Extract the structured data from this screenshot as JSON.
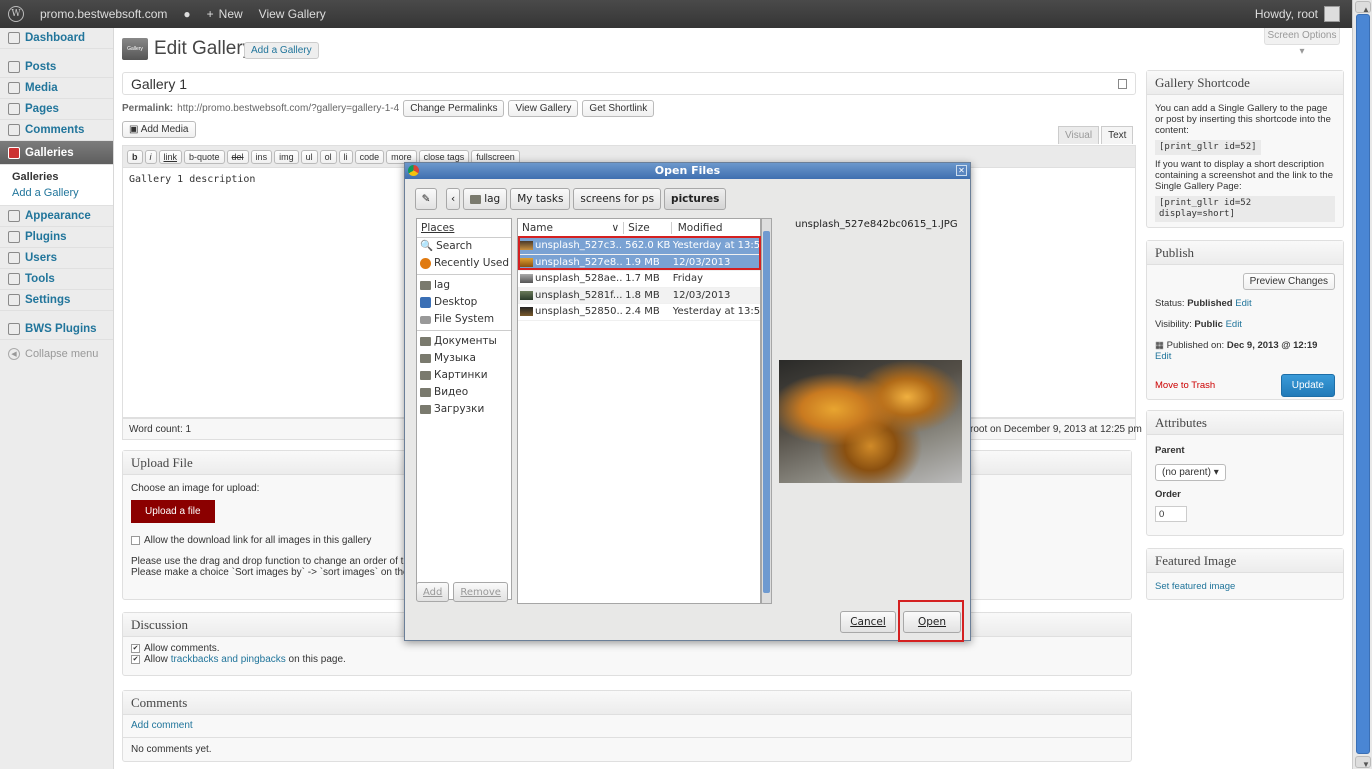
{
  "adminbar": {
    "site": "promo.bestwebsoft.com",
    "new": "New",
    "view": "View Gallery",
    "howdy": "Howdy, root"
  },
  "menu": {
    "dashboard": "Dashboard",
    "posts": "Posts",
    "media": "Media",
    "pages": "Pages",
    "comments": "Comments",
    "galleries": "Galleries",
    "sub_galleries": "Galleries",
    "sub_add": "Add a Gallery",
    "appearance": "Appearance",
    "plugins": "Plugins",
    "users": "Users",
    "tools": "Tools",
    "settings": "Settings",
    "bws": "BWS Plugins",
    "collapse": "Collapse menu"
  },
  "screen_options": "Screen Options",
  "page": {
    "title": "Edit Gallery",
    "add_new": "Add a Gallery",
    "post_title": "Gallery 1",
    "permalink_label": "Permalink:",
    "permalink_url": "http://promo.bestwebsoft.com/?gallery=gallery-1-4",
    "change_permalinks": "Change Permalinks",
    "view_gallery": "View Gallery",
    "get_shortlink": "Get Shortlink",
    "add_media": "Add Media",
    "tab_visual": "Visual",
    "tab_text": "Text",
    "content": "Gallery 1 description",
    "word_count": "Word count: 1",
    "last_edit": "root on December 9, 2013 at 12:25 pm"
  },
  "qt": [
    "b",
    "i",
    "link",
    "b-quote",
    "del",
    "ins",
    "img",
    "ul",
    "ol",
    "li",
    "code",
    "more",
    "close tags",
    "fullscreen"
  ],
  "upload": {
    "title": "Upload File",
    "choose": "Choose an image for upload:",
    "button": "Upload a file",
    "allow": "Allow the download link for all images in this gallery",
    "note1": "Please use the drag and drop function to change an order of the images",
    "note2": "Please make a choice `Sort images by` -> `sort images` on the plugin se"
  },
  "discussion": {
    "title": "Discussion",
    "allow_comments": "Allow comments.",
    "allow_pre": "Allow ",
    "allow_link": "trackbacks and pingbacks",
    "allow_post": " on this page."
  },
  "comments": {
    "title": "Comments",
    "add": "Add comment",
    "none": "No comments yet."
  },
  "shortcode": {
    "title": "Gallery Shortcode",
    "text1": "You can add a Single Gallery to the page or post by inserting this shortcode into the content:",
    "code1": "[print_gllr id=52]",
    "text2": "If you want to display a short description containing a screenshot and the link to the Single Gallery Page:",
    "code2": "[print_gllr id=52 display=short]"
  },
  "publish": {
    "title": "Publish",
    "preview": "Preview Changes",
    "status_label": "Status:",
    "status": "Published",
    "visibility_label": "Visibility:",
    "visibility": "Public",
    "published_on_label": "Published on:",
    "published_on": "Dec 9, 2013 @ 12:19",
    "edit": "Edit",
    "trash": "Move to Trash",
    "update": "Update"
  },
  "attributes": {
    "title": "Attributes",
    "parent_label": "Parent",
    "parent_value": "(no parent)",
    "order_label": "Order",
    "order_value": "0"
  },
  "featured": {
    "title": "Featured Image",
    "link": "Set featured image"
  },
  "dialog": {
    "title": "Open Files",
    "path": [
      "lag",
      "My tasks",
      "screens for ps",
      "pictures"
    ],
    "places_header": "Places",
    "places": [
      {
        "name": "Search",
        "icon": "search-icon"
      },
      {
        "name": "Recently Used",
        "icon": "recent-icon"
      },
      {
        "name": "lag",
        "icon": "folder-icon"
      },
      {
        "name": "Desktop",
        "icon": "desktop-icon"
      },
      {
        "name": "File System",
        "icon": "drive-icon"
      },
      {
        "name": "Документы",
        "icon": "folder-icon"
      },
      {
        "name": "Музыка",
        "icon": "folder-icon"
      },
      {
        "name": "Картинки",
        "icon": "folder-icon"
      },
      {
        "name": "Видео",
        "icon": "folder-icon"
      },
      {
        "name": "Загрузки",
        "icon": "folder-icon"
      }
    ],
    "col_name": "Name",
    "col_size": "Size",
    "col_modified": "Modified",
    "files": [
      {
        "name": "unsplash_527c3...",
        "size": "562.0 KB",
        "modified": "Yesterday at 13:58",
        "selected": true
      },
      {
        "name": "unsplash_527e8...",
        "size": "1.9 MB",
        "modified": "12/03/2013",
        "selected": true
      },
      {
        "name": "unsplash_528ae...",
        "size": "1.7 MB",
        "modified": "Friday",
        "selected": false
      },
      {
        "name": "unsplash_5281f...",
        "size": "1.8 MB",
        "modified": "12/03/2013",
        "selected": false
      },
      {
        "name": "unsplash_52850...",
        "size": "2.4 MB",
        "modified": "Yesterday at 13:59",
        "selected": false
      }
    ],
    "preview_name": "unsplash_527e842bc0615_1.JPG",
    "add": "Add",
    "remove": "Remove",
    "cancel": "Cancel",
    "open": "Open"
  }
}
